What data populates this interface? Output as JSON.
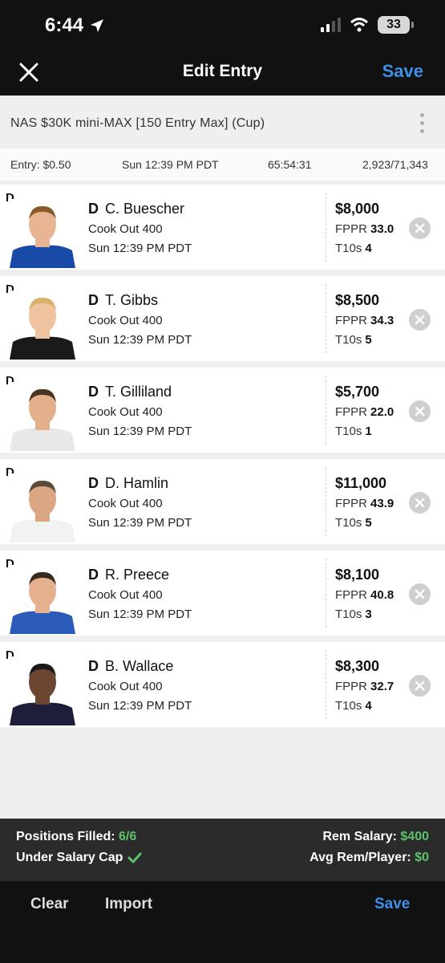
{
  "status": {
    "time": "6:44",
    "battery": "33"
  },
  "nav": {
    "title": "Edit Entry",
    "save": "Save"
  },
  "contest": {
    "name": "NAS $30K mini-MAX [150 Entry Max] (Cup)",
    "entry": "Entry: $0.50",
    "start": "Sun 12:39 PM PDT",
    "countdown": "65:54:31",
    "entries": "2,923/71,343"
  },
  "labels": {
    "fppr": "FPPR",
    "t10s": "T10s",
    "pos": "D"
  },
  "players": [
    {
      "name": "C. Buescher",
      "event": "Cook Out 400",
      "time": "Sun 12:39 PM PDT",
      "salary": "$8,000",
      "fppr": "33.0",
      "t10s": "4",
      "suit": "#1a4aa8",
      "skin": "#e7b593",
      "hair": "#8a5a2b"
    },
    {
      "name": "T. Gibbs",
      "event": "Cook Out 400",
      "time": "Sun 12:39 PM PDT",
      "salary": "$8,500",
      "fppr": "34.3",
      "t10s": "5",
      "suit": "#1a1a1a",
      "skin": "#f0c3a0",
      "hair": "#d8b36a"
    },
    {
      "name": "T. Gilliland",
      "event": "Cook Out 400",
      "time": "Sun 12:39 PM PDT",
      "salary": "$5,700",
      "fppr": "22.0",
      "t10s": "1",
      "suit": "#e8e8e8",
      "skin": "#e3b08c",
      "hair": "#4a3322"
    },
    {
      "name": "D. Hamlin",
      "event": "Cook Out 400",
      "time": "Sun 12:39 PM PDT",
      "salary": "$11,000",
      "fppr": "43.9",
      "t10s": "5",
      "suit": "#f2f2f2",
      "skin": "#dba684",
      "hair": "#5a4a3a"
    },
    {
      "name": "R. Preece",
      "event": "Cook Out 400",
      "time": "Sun 12:39 PM PDT",
      "salary": "$8,100",
      "fppr": "40.8",
      "t10s": "3",
      "suit": "#2a5bb8",
      "skin": "#e4b08e",
      "hair": "#3a2a1e"
    },
    {
      "name": "B. Wallace",
      "event": "Cook Out 400",
      "time": "Sun 12:39 PM PDT",
      "salary": "$8,300",
      "fppr": "32.7",
      "t10s": "4",
      "suit": "#1e1e3a",
      "skin": "#6b4631",
      "hair": "#1a1a1a"
    }
  ],
  "summary": {
    "positions_label": "Positions Filled:",
    "positions_value": "6/6",
    "cap_label": "Under Salary Cap",
    "rem_label": "Rem Salary:",
    "rem_value": "$400",
    "avg_label": "Avg Rem/Player:",
    "avg_value": "$0"
  },
  "bottom": {
    "clear": "Clear",
    "import": "Import",
    "save": "Save"
  },
  "colors": {
    "accent": "#3f8fe6",
    "success": "#5cc26a"
  }
}
